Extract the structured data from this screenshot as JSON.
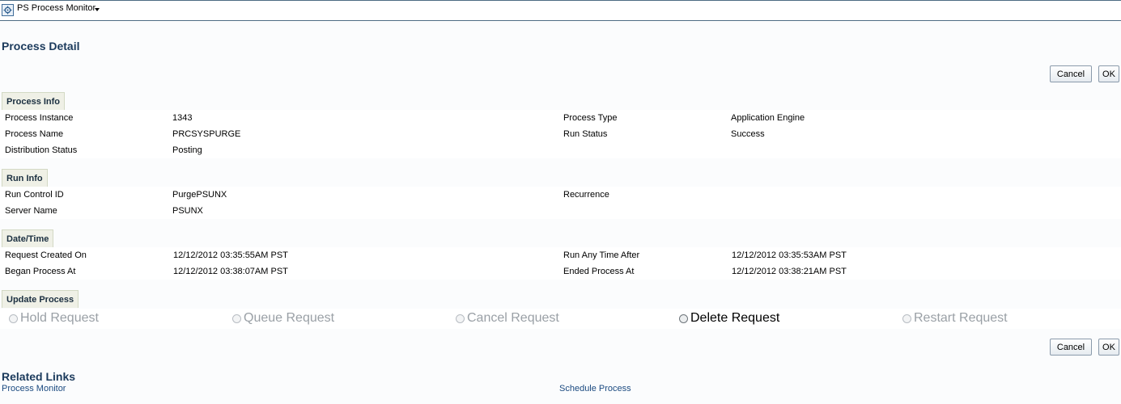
{
  "topbar": {
    "title": "PS Process Monitor",
    "icon": "process-monitor-icon"
  },
  "page_title": "Process Detail",
  "buttons": {
    "cancel": "Cancel",
    "ok": "OK"
  },
  "process_info": {
    "header": "Process Info",
    "process_instance_label": "Process Instance",
    "process_instance_value": "1343",
    "process_type_label": "Process Type",
    "process_type_value": "Application Engine",
    "process_name_label": "Process Name",
    "process_name_value": "PRCSYSPURGE",
    "run_status_label": "Run Status",
    "run_status_value": "Success",
    "distribution_status_label": "Distribution Status",
    "distribution_status_value": "Posting"
  },
  "run_info": {
    "header": "Run Info",
    "run_control_id_label": "Run Control ID",
    "run_control_id_value": "PurgePSUNX",
    "recurrence_label": "Recurrence",
    "server_name_label": "Server Name",
    "server_name_value": "PSUNX"
  },
  "date_time": {
    "header": "Date/Time",
    "request_created_label": "Request Created On",
    "request_created_value": "12/12/2012 03:35:55AM PST",
    "run_any_time_label": "Run Any Time After",
    "run_any_time_value": "12/12/2012 03:35:53AM PST",
    "began_label": "Began Process At",
    "began_value": "12/12/2012 03:38:07AM PST",
    "ended_label": "Ended Process At",
    "ended_value": "12/12/2012 03:38:21AM PST"
  },
  "update_process": {
    "header": "Update Process",
    "options": [
      "Hold Request",
      "Queue Request",
      "Cancel Request",
      "Delete Request",
      "Restart Request"
    ]
  },
  "related_links": {
    "header": "Related Links",
    "process_monitor": "Process Monitor",
    "schedule_process": "Schedule Process"
  }
}
